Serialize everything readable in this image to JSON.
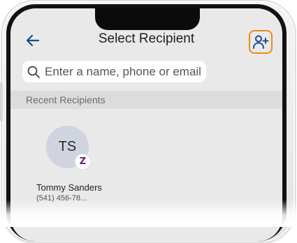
{
  "header": {
    "title": "Select Recipient",
    "back_icon": "back-arrow-icon",
    "add_contact_icon": "add-person-icon"
  },
  "search": {
    "placeholder": "Enter a name, phone or email",
    "icon": "search-icon"
  },
  "recent": {
    "section_title": "Recent Recipients",
    "recipients": [
      {
        "initials": "TS",
        "name": "Tommy Sanders",
        "phone": "(541) 456-78...",
        "badge": "Z",
        "badge_icon": "zelle-icon"
      }
    ]
  },
  "colors": {
    "accent": "#f08a16",
    "icon_blue": "#1c4a8f",
    "zelle_purple": "#6d1e70",
    "screen_bg": "#e9e9e9"
  }
}
